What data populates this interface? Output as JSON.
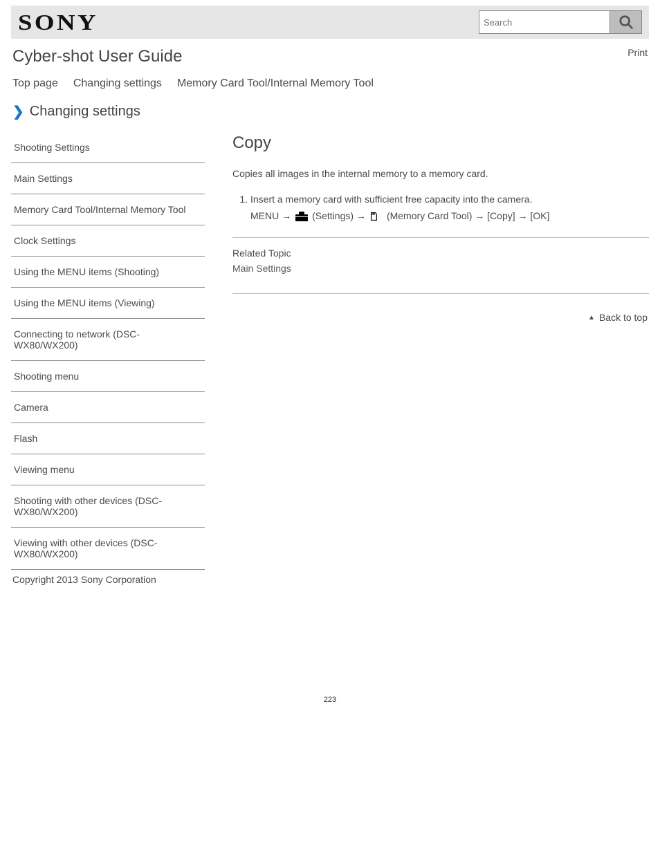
{
  "header": {
    "logo": "SONY",
    "user_guide": "Cyber-shot User Guide",
    "search_placeholder": "Search",
    "print_label": "Print"
  },
  "topnav": [
    "Top page",
    "Changing settings",
    "Memory Card Tool/Internal Memory Tool"
  ],
  "breadcrumb": {
    "category": "Changing settings"
  },
  "sidebar": [
    "Shooting Settings",
    "Main Settings",
    "Memory Card Tool/Internal Memory Tool",
    "Clock Settings",
    "Using the MENU items (Shooting)",
    "Using the MENU items (Viewing)",
    "Connecting to network (DSC-WX80/WX200)",
    "Shooting menu",
    "Camera",
    "Flash",
    "Viewing menu",
    "Shooting with other devices (DSC-WX80/WX200)",
    "Viewing with other devices (DSC-WX80/WX200)"
  ],
  "main": {
    "title": "Copy",
    "paragraph": "Copies all images in the internal memory to a memory card.",
    "step_prefix": "Insert a memory card with sufficient free capacity into the camera.",
    "step_menu_path_1": "MENU →",
    "step_menu_path_2": "(Settings) →",
    "step_menu_path_3": "(Memory Card Tool) → [Copy] → [OK]",
    "rel_heading": "Related Topic",
    "rel_link": "Main Settings"
  },
  "back_top": "Back to top",
  "footer": {
    "copyright": "Copyright 2013 Sony Corporation"
  },
  "page_number": "223"
}
